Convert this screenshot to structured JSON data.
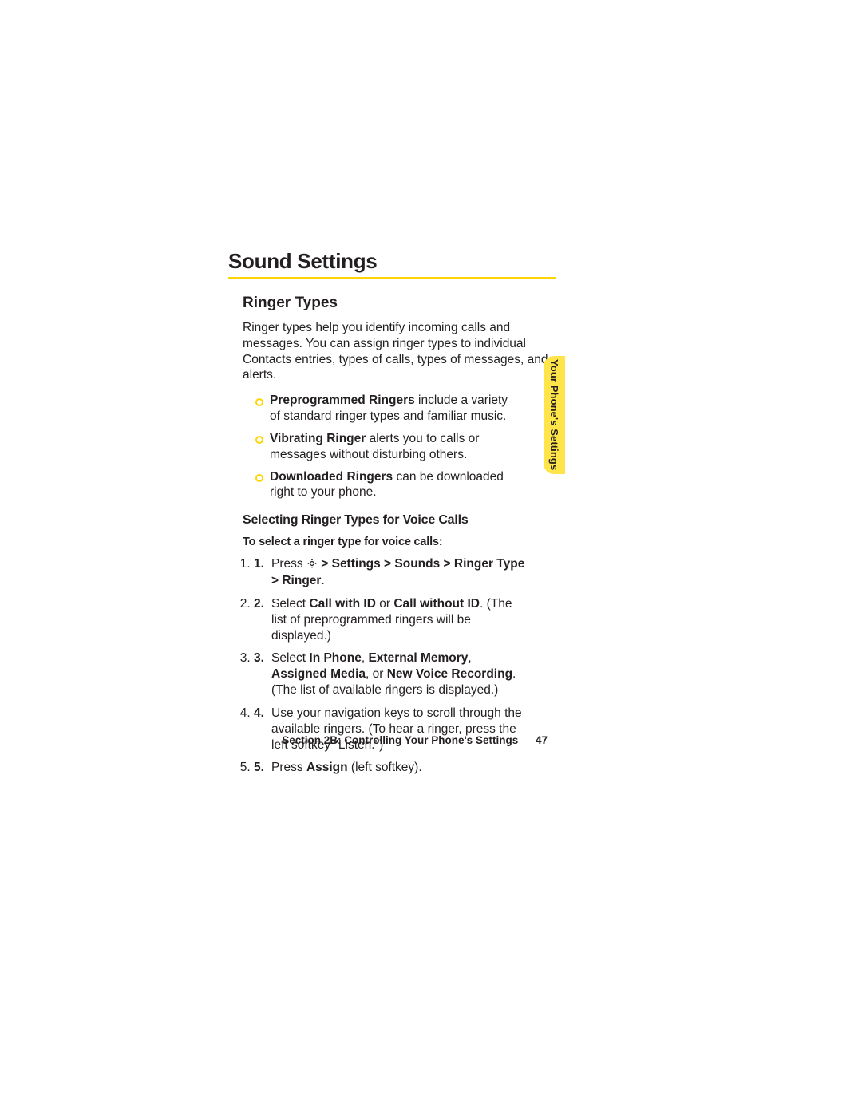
{
  "heading": "Sound Settings",
  "subheading": "Ringer Types",
  "intro": "Ringer types help you identify incoming calls and messages. You can assign ringer types to individual Contacts entries, types of calls, types of messages, and alerts.",
  "bullets": [
    {
      "bold": "Preprogrammed Ringers",
      "rest": " include a variety of standard ringer types and familiar music."
    },
    {
      "bold": "Vibrating Ringer",
      "rest": " alerts you to calls or messages without disturbing others."
    },
    {
      "bold": "Downloaded Ringers",
      "rest": " can be downloaded right to your phone."
    }
  ],
  "subhead3": "Selecting Ringer Types for Voice Calls",
  "subhead4": "To select a ringer type for voice calls:",
  "steps": {
    "s1": {
      "num": "1.",
      "a": "Press ",
      "b": " > Settings > Sounds > Ringer Type > Ringer",
      "c": "."
    },
    "s2": {
      "num": "2.",
      "a": "Select ",
      "b1": "Call with ID",
      "mid": " or ",
      "b2": "Call without ID",
      "c": ". (The list of preprogrammed ringers will be displayed.)"
    },
    "s3": {
      "num": "3.",
      "a": "Select ",
      "b1": "In Phone",
      "c1": ", ",
      "b2": "External Memory",
      "c2": ", ",
      "b3": "Assigned Media",
      "c3": ", or ",
      "b4": "New Voice Recording",
      "c4": ". (The list of available ringers is displayed.)"
    },
    "s4": {
      "num": "4.",
      "a": "Use your navigation keys to scroll through the available ringers. (To hear a ringer, press the left softkey \"Listen.\")"
    },
    "s5": {
      "num": "5.",
      "a": "Press ",
      "b": "Assign",
      "c": " (left softkey)."
    }
  },
  "tab_label": "Your Phone's Settings",
  "footer_section": "Section 2B: Controlling Your Phone's Settings",
  "footer_page": "47"
}
